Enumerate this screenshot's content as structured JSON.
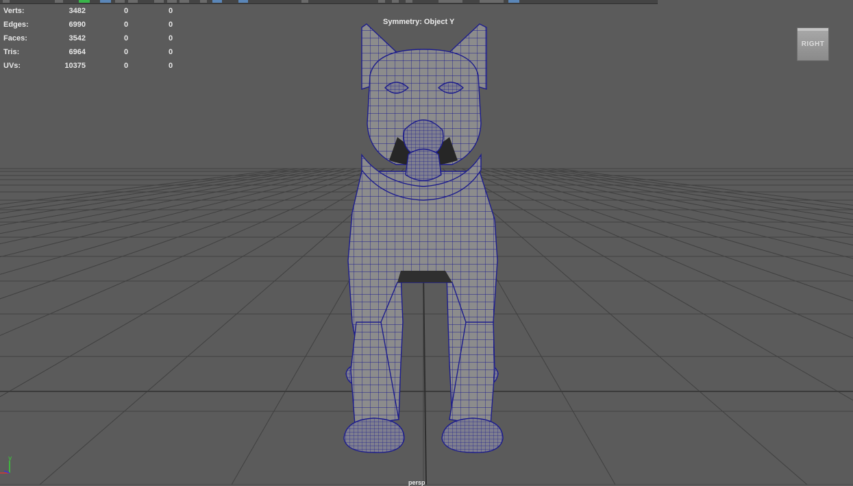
{
  "viewport": {
    "symmetry": "Symmetry: Object Y",
    "view_cube": "RIGHT",
    "camera": "persp",
    "axis_y": "y"
  },
  "stats": [
    {
      "label": "Verts:",
      "v1": "3482",
      "v2": "0",
      "v3": "0"
    },
    {
      "label": "Edges:",
      "v1": "6990",
      "v2": "0",
      "v3": "0"
    },
    {
      "label": "Faces:",
      "v1": "3542",
      "v2": "0",
      "v3": "0"
    },
    {
      "label": "Tris:",
      "v1": "6964",
      "v2": "0",
      "v3": "0"
    },
    {
      "label": "UVs:",
      "v1": "10375",
      "v2": "0",
      "v3": "0"
    }
  ],
  "colors": {
    "viewport_bg": "#5b5b5b",
    "grid": "#404040",
    "mesh_fill": "#8c8c8c",
    "wireframe": "#1c1c8c",
    "axis_y": "#37d437",
    "axis_x": "#d43737",
    "axis_z": "#3737d4"
  }
}
